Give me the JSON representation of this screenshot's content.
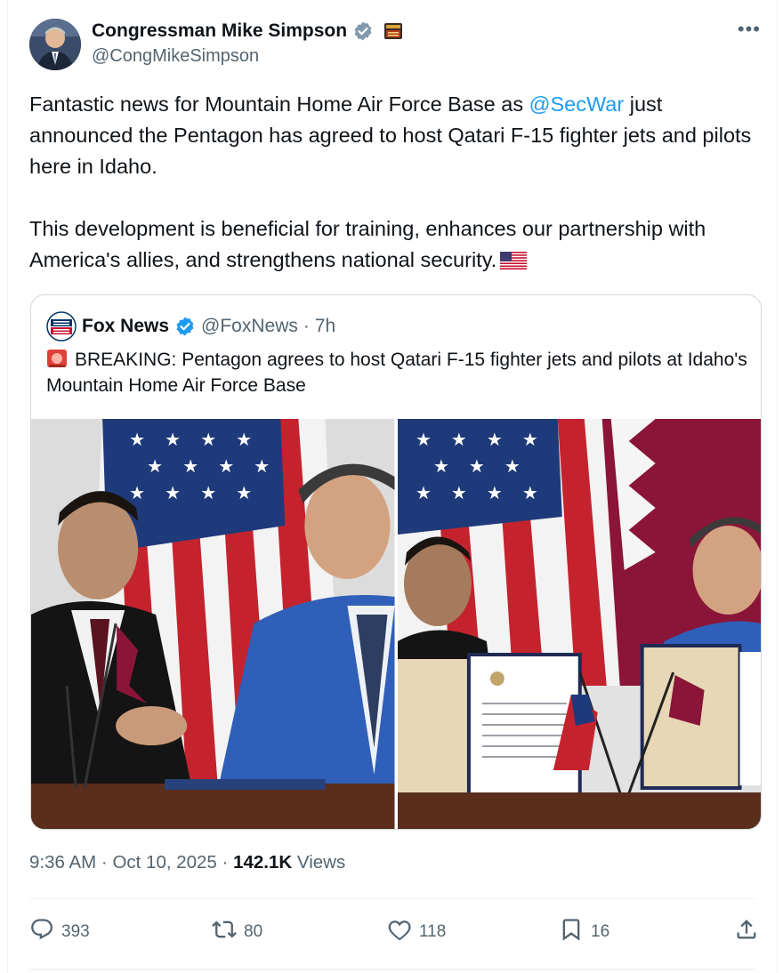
{
  "author": {
    "name": "Congressman Mike Simpson",
    "handle": "@CongMikeSimpson"
  },
  "tweet": {
    "line1_pre": "Fantastic news for Mountain Home Air Force Base as ",
    "mention": "@SecWar",
    "line1_post": " just announced the Pentagon has agreed to host Qatari F-15 fighter jets and pilots here in Idaho.",
    "paragraph2": "This development is beneficial for training, enhances our partnership with America's allies, and strengthens national security."
  },
  "quote": {
    "name": "Fox News",
    "handle": "@FoxNews",
    "separator": "·",
    "time": "7h",
    "text": "BREAKING: Pentagon agrees to host Qatari F-15 fighter jets and pilots at Idaho's Mountain Home Air Force Base"
  },
  "meta": {
    "time": "9:36 AM",
    "sep1": "·",
    "date": "Oct 10, 2025",
    "sep2": "·",
    "views_count": "142.1K",
    "views_label": "Views"
  },
  "actions": {
    "replies": "393",
    "reposts": "80",
    "likes": "118",
    "bookmarks": "16"
  },
  "colors": {
    "link": "#1d9bf0",
    "muted_text": "#536471",
    "border": "#cfd9de",
    "verified": "#1d9bf0",
    "verified_gov": "#829aab"
  },
  "icons": {
    "more": "more-horizontal-icon",
    "reply": "reply-icon",
    "repost": "repost-icon",
    "like": "heart-icon",
    "bookmark": "bookmark-icon",
    "share": "share-icon"
  }
}
